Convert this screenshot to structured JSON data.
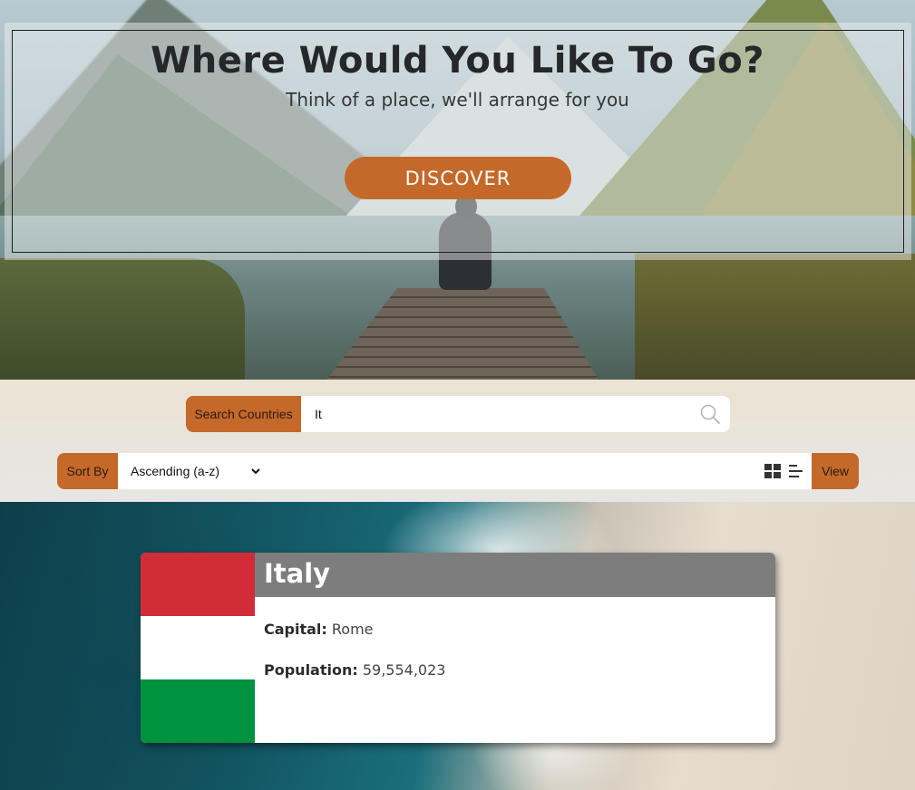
{
  "hero": {
    "title": "Where Would You Like To Go?",
    "subtitle": "Think of a place, we'll arrange for you",
    "discover_label": "DISCOVER"
  },
  "search": {
    "label": "Search Countries",
    "value": "It"
  },
  "sort": {
    "label": "Sort By",
    "selected": "Ascending (a-z)",
    "options": [
      "Ascending (a-z)"
    ]
  },
  "view": {
    "label": "View",
    "icons": [
      "grid-view-icon",
      "list-view-icon"
    ]
  },
  "results": [
    {
      "name": "Italy",
      "capital_label": "Capital:",
      "capital": "Rome",
      "population_label": "Population:",
      "population": "59,554,023",
      "flag_colors": [
        "#d12c37",
        "#ffffff",
        "#00923f"
      ]
    }
  ],
  "colors": {
    "accent": "#c4692a",
    "card_header": "#7d7d7d"
  }
}
